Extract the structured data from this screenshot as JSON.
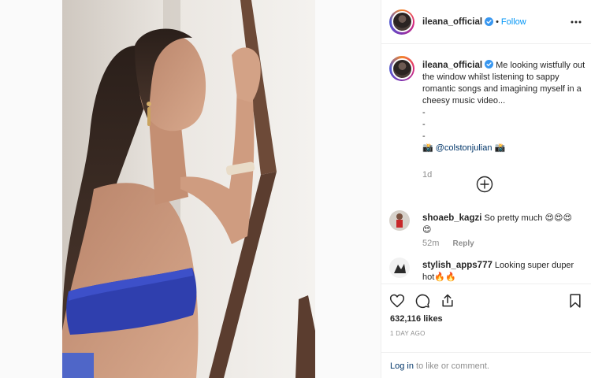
{
  "post": {
    "username": "ileana_official",
    "follow_label": "Follow",
    "dot": "•"
  },
  "caption": {
    "username": "ileana_official",
    "text": "Me looking wistfully out the window whilst listening to sappy romantic songs and imagining myself in a cheesy music video...",
    "lines": [
      "-",
      "-",
      "-"
    ],
    "credit_prefix": "📸",
    "mention": "@colstonjulian",
    "credit_suffix": "📸",
    "time": "1d"
  },
  "comments": [
    {
      "username": "shoaeb_kagzi",
      "text": "So pretty much 😍😍😍😍",
      "time": "52m",
      "reply_label": "Reply"
    },
    {
      "username": "stylish_apps777",
      "text": "Looking super duper hot🔥🔥"
    }
  ],
  "actions": {
    "likes": "632,116 likes",
    "date": "1 DAY AGO"
  },
  "login": {
    "link": "Log in",
    "rest": " to like or comment."
  },
  "colors": {
    "accent": "#0095f6",
    "verified": "#3897f0",
    "bikini": "#2f3fae"
  }
}
